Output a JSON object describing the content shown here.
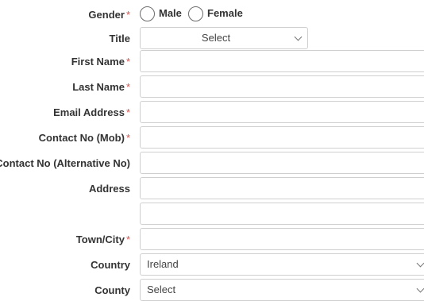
{
  "form": {
    "gender": {
      "label": "Gender",
      "required": "*",
      "options": [
        "Male",
        "Female"
      ]
    },
    "title": {
      "label": "Title",
      "selected": "Select"
    },
    "first_name": {
      "label": "First Name",
      "required": "*",
      "value": ""
    },
    "last_name": {
      "label": "Last Name",
      "required": "*",
      "value": ""
    },
    "email": {
      "label": "Email Address",
      "required": "*",
      "value": ""
    },
    "contact_mob": {
      "label": "Contact No (Mob)",
      "required": "*",
      "value": ""
    },
    "contact_alt": {
      "label": "Contact No (Alternative No)",
      "value": ""
    },
    "address": {
      "label": "Address",
      "line1": "",
      "line2": ""
    },
    "town": {
      "label": "Town/City",
      "required": "*",
      "value": ""
    },
    "country": {
      "label": "Country",
      "selected": "Ireland"
    },
    "county": {
      "label": "County",
      "selected": "Select"
    }
  },
  "colors": {
    "required": "#d9534f",
    "border": "#cfcfcf",
    "label": "#333333"
  },
  "icons": {
    "dropdown": "chevron-down-icon"
  }
}
